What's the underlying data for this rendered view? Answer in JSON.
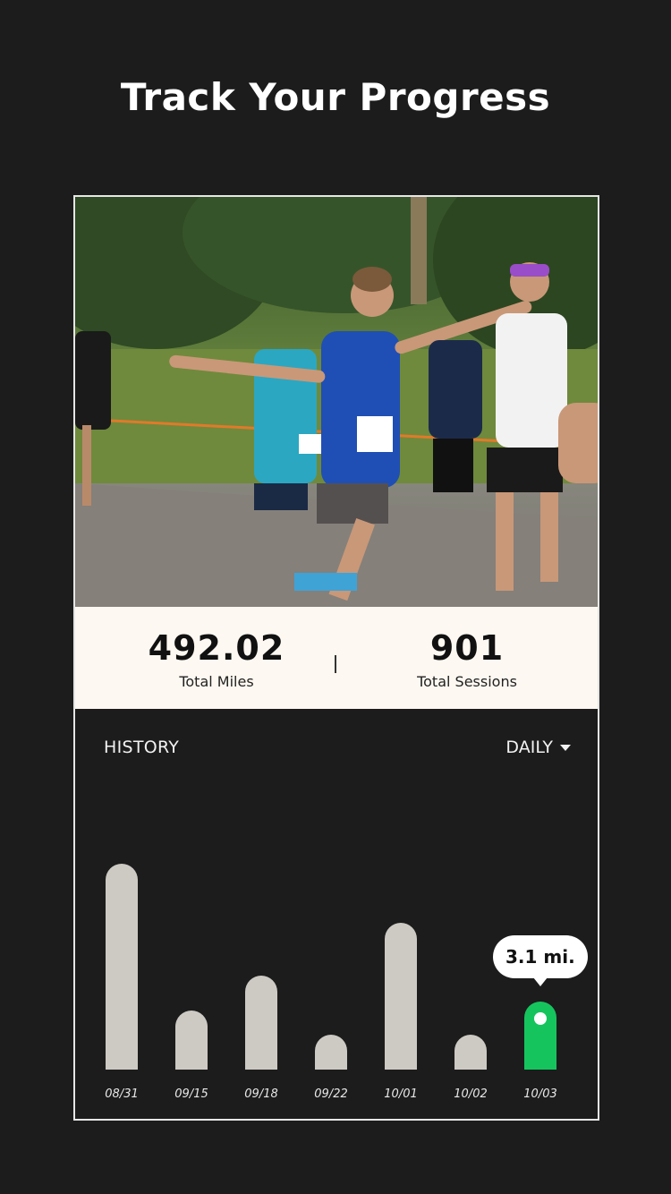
{
  "headline": "Track Your Progress",
  "stats": {
    "total_miles_value": "492.02",
    "total_miles_label": "Total Miles",
    "total_sessions_value": "901",
    "total_sessions_label": "Total Sessions"
  },
  "history": {
    "title": "HISTORY",
    "period": "DAILY"
  },
  "colors": {
    "bar": "#cdc9c3",
    "bar_selected": "#16c45e"
  },
  "chart_data": {
    "type": "bar",
    "categories": [
      "08/31",
      "09/15",
      "09/18",
      "09/22",
      "10/01",
      "10/02",
      "10/03"
    ],
    "values": [
      9.4,
      2.7,
      4.3,
      1.6,
      6.7,
      1.6,
      3.1
    ],
    "selected_index": 6,
    "selected_label": "3.1 mi.",
    "ylim": [
      0,
      10
    ]
  }
}
